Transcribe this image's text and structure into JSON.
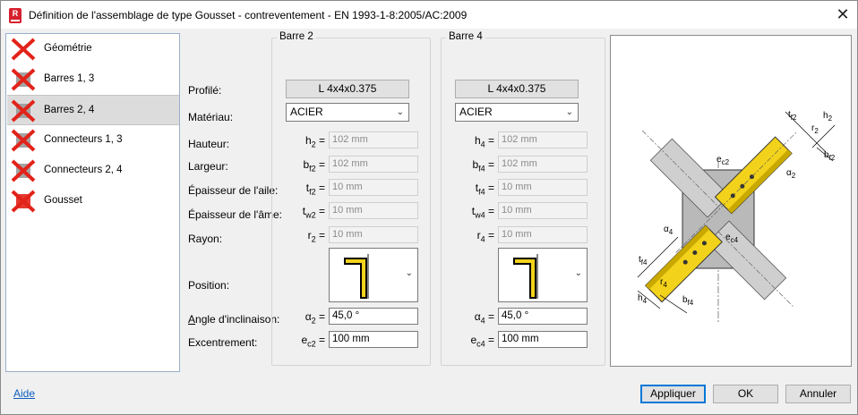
{
  "window": {
    "title": "Définition de l'assemblage de type Gousset - contreventement  - EN 1993-1-8:2005/AC:2009",
    "app_icon_letter": "R",
    "close_symbol": "✕"
  },
  "sidebar": {
    "selected_index": 2,
    "items": [
      {
        "label": "Géométrie",
        "icon": "geometry-cross-icon"
      },
      {
        "label": "Barres 1, 3",
        "icon": "bars-cross-icon"
      },
      {
        "label": "Barres 2, 4",
        "icon": "bars-cross-icon"
      },
      {
        "label": "Connecteurs 1, 3",
        "icon": "connectors-cross-icon"
      },
      {
        "label": "Connecteurs 2, 4",
        "icon": "connectors-cross-icon"
      },
      {
        "label": "Gousset",
        "icon": "gusset-cross-icon"
      }
    ]
  },
  "labels": {
    "profile": "Profilé:",
    "material": "Matériau:",
    "height": "Hauteur:",
    "width": "Largeur:",
    "flange_thickness": "Épaisseur de l'aile:",
    "web_thickness": "Épaisseur de l'âme:",
    "radius": "Rayon:",
    "position": "Position:",
    "angle_first": "A",
    "angle_rest": "ngle d'inclinaison:",
    "eccentricity": "Excentrement:"
  },
  "bar2": {
    "title": "Barre 2",
    "profile": "L 4x4x0.375",
    "material": "ACIER",
    "height": {
      "sym": "h",
      "sub": "2",
      "value": "102 mm"
    },
    "width": {
      "sym": "b",
      "sub": "f2",
      "value": "102 mm"
    },
    "flange": {
      "sym": "t",
      "sub": "f2",
      "value": "10 mm"
    },
    "web": {
      "sym": "t",
      "sub": "w2",
      "value": "10 mm"
    },
    "radius": {
      "sym": "r",
      "sub": "2",
      "value": "10 mm"
    },
    "angle": {
      "sym": "α",
      "sub": "2",
      "value": "45,0 °"
    },
    "ecc": {
      "sym": "e",
      "sub": "c2",
      "value": "100 mm"
    }
  },
  "bar4": {
    "title": "Barre 4",
    "profile": "L 4x4x0.375",
    "material": "ACIER",
    "height": {
      "sym": "h",
      "sub": "4",
      "value": "102 mm"
    },
    "width": {
      "sym": "b",
      "sub": "f4",
      "value": "102 mm"
    },
    "flange": {
      "sym": "t",
      "sub": "f4",
      "value": "10 mm"
    },
    "web": {
      "sym": "t",
      "sub": "w4",
      "value": "10 mm"
    },
    "radius": {
      "sym": "r",
      "sub": "4",
      "value": "10 mm"
    },
    "angle": {
      "sym": "α",
      "sub": "4",
      "value": "45,0 °"
    },
    "ecc": {
      "sym": "e",
      "sub": "c4",
      "value": "100 mm"
    }
  },
  "diagram": {
    "labels": {
      "tf2": "t",
      "tf2_sub": "f2",
      "h2": "h",
      "h2_sub": "2",
      "r2": "r",
      "r2_sub": "2",
      "bf2": "b",
      "bf2_sub": "f2",
      "ec2": "e",
      "ec2_sub": "c2",
      "a2": "α",
      "a2_sub": "2",
      "a4": "α",
      "a4_sub": "4",
      "ec4": "e",
      "ec4_sub": "c4",
      "tf4": "t",
      "tf4_sub": "f4",
      "r4": "r",
      "r4_sub": "4",
      "h4": "h",
      "h4_sub": "4",
      "bf4": "b",
      "bf4_sub": "f4"
    },
    "colors": {
      "gusset": "#b9b9b9",
      "member": "#cfcfcf",
      "angle_steel": "#f2d21b"
    }
  },
  "footer": {
    "help": "Aide",
    "apply": "Appliquer",
    "ok": "OK",
    "cancel": "Annuler"
  },
  "combo_symbol": "⌄",
  "equals": "="
}
